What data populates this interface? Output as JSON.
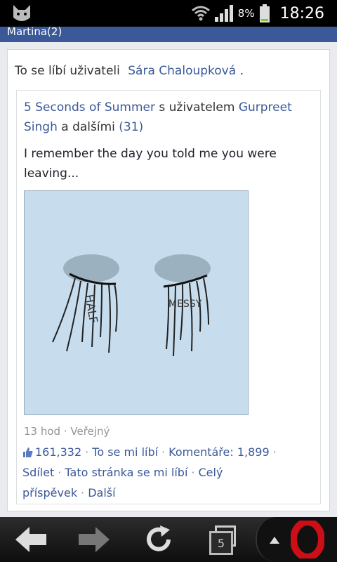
{
  "status": {
    "battery_pct": "8%",
    "time": "18:26",
    "icons": [
      "app-cat-icon",
      "wifi-icon",
      "signal-icon",
      "battery-icon"
    ]
  },
  "header": {
    "title": "Martina(2)"
  },
  "story": {
    "liked_prefix": "To se líbí uživateli",
    "liked_name": "Sára Chaloupková",
    "liked_suffix": ".",
    "page_name": "5 Seconds of Summer",
    "with_text": "s uživatelem",
    "tagged_name": "Gurpreet Singh",
    "and_others": "a dalšími",
    "others_count": "(31)",
    "post_text": "I remember the day you told me you were leaving...",
    "time_ago": "13 hod",
    "privacy": "Veřejný",
    "like_count": "161,332",
    "like_link": "To se mi líbí",
    "comments_label": "Komentáře:",
    "comments_count": "1,899",
    "share": "Sdílet",
    "page_like": "Tato stránka se mi líbí",
    "full_post": "Celý příspěvek",
    "more": "Další",
    "image_text": [
      "HALF",
      "MESSY"
    ]
  },
  "navbar": {
    "tabs_count": "5",
    "colors": {
      "opera": "#cc0f16"
    }
  }
}
